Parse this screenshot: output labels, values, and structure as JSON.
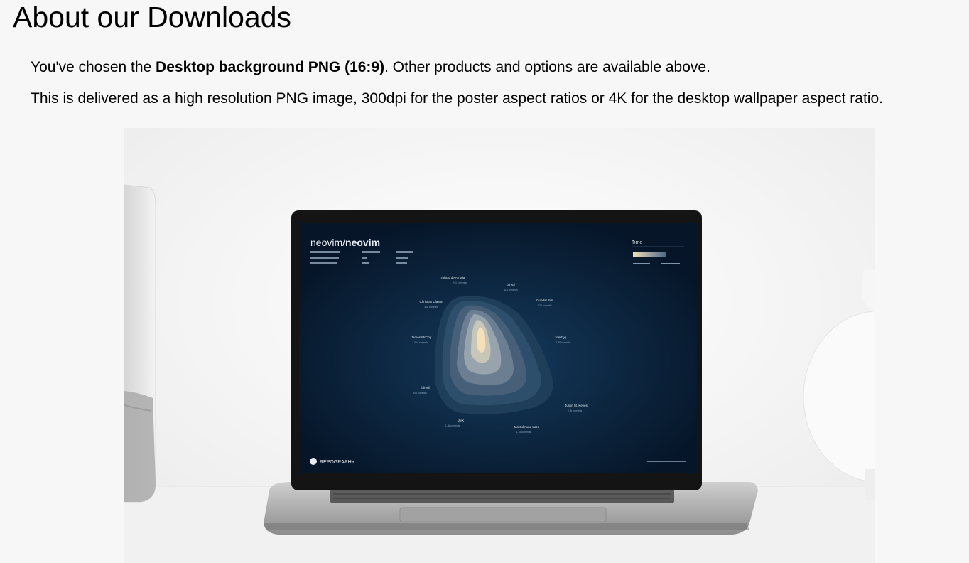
{
  "page": {
    "title": "About our Downloads"
  },
  "intro": {
    "prefix": "You've chosen the ",
    "product": "Desktop background PNG (16:9)",
    "suffix": ". Other products and options are available above."
  },
  "description": "This is delivered as a high resolution PNG image, 300dpi for the poster aspect ratios or 4K for the desktop wallpaper aspect ratio.",
  "preview": {
    "repo_owner": "neovim/",
    "repo_name": "neovim",
    "legend_title": "Time",
    "brand": "REPOGRAPHY",
    "contributors": [
      {
        "name": "Thiago de Arruda",
        "commits": "741 commits"
      },
      {
        "name": "bfredl",
        "commits": "116 commits"
      },
      {
        "name": "Christian Clason",
        "commits": "336 commits"
      },
      {
        "name": "Gundar Sdc",
        "commits": "475 commits"
      },
      {
        "name": "James McCoy",
        "commits": "604 commits"
      },
      {
        "name": "zeertzjq",
        "commits": "1.55 commits"
      },
      {
        "name": "bfredl",
        "commits": "906 commits"
      },
      {
        "name": "Justin M. Keyes",
        "commits": "2.2k commits"
      },
      {
        "name": "ZyX",
        "commits": "1.4k commits"
      },
      {
        "name": "Jan Edmund Lazo",
        "commits": "1.1k commits"
      }
    ],
    "colors": {
      "screen_dark": "#07192c",
      "screen_mid": "#0e3150",
      "blob_light": "#f4dfb9",
      "laptop_body": "#b9b9b9"
    }
  }
}
